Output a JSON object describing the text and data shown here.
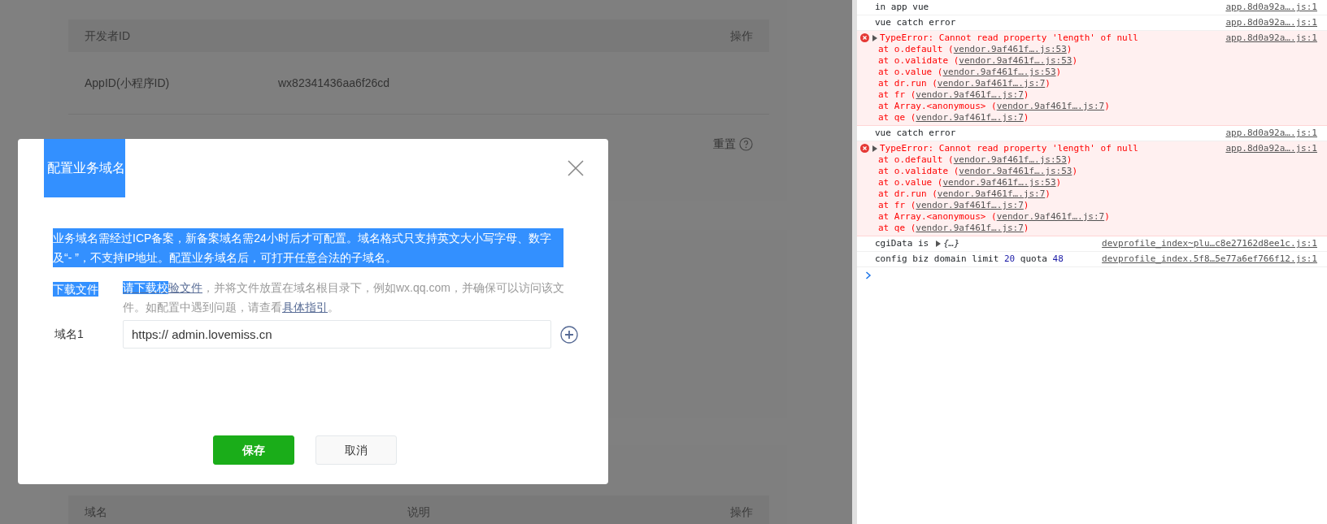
{
  "background_page": {
    "developer_card": {
      "columns": [
        "开发者ID",
        "操作"
      ],
      "rows": [
        {
          "label": "AppID(小程序ID)",
          "value": "wx82341436aa6f26cd"
        }
      ],
      "reset_link": "重置"
    },
    "domain_card": {
      "columns": [
        "域名",
        "说明",
        "操作"
      ]
    }
  },
  "modal": {
    "title": "配置业务域名",
    "title_highlighted": true,
    "description": {
      "text": "业务域名需经过ICP备案，新备案域名需24小时后才可配置。域名格式只支持英文大小写字母、数字及“- ”，不支持IP地址。配置业务域名后，可打开任意合法的子域名。",
      "highlighted": true
    },
    "download": {
      "label": "下载文件",
      "label_highlighted": true,
      "link": [
        {
          "text": "请下载校",
          "highlighted": true
        },
        {
          "text": "验文件",
          "highlighted": false
        }
      ],
      "middle": "，并将文件放置在域名根目录下，例如wx.qq.com，并确保可以访问该文件。如配置中遇到问题，请查看",
      "guide_link": "具体指引",
      "end": "。"
    },
    "domain_fields": [
      {
        "label": "域名1",
        "value": "https:// admin.lovemiss.cn"
      }
    ],
    "buttons": [
      {
        "label": "保存",
        "kind": "primary"
      },
      {
        "label": "取消",
        "kind": "default"
      }
    ]
  },
  "console": [
    {
      "kind": "log",
      "text": "in app vue",
      "source": "app.8d0a92a….js:1"
    },
    {
      "kind": "log",
      "text": "vue catch error",
      "source": "app.8d0a92a….js:1"
    },
    {
      "kind": "error",
      "message": "TypeError: Cannot read property 'length' of null",
      "source": "app.8d0a92a….js:1",
      "stack": [
        {
          "pre": "at o.default (",
          "link": "vendor.9af461f….js:53",
          "post": ")"
        },
        {
          "pre": "at o.validate (",
          "link": "vendor.9af461f….js:53",
          "post": ")"
        },
        {
          "pre": "at o.value (",
          "link": "vendor.9af461f….js:53",
          "post": ")"
        },
        {
          "pre": "at dr.run (",
          "link": "vendor.9af461f….js:7",
          "post": ")"
        },
        {
          "pre": "at fr (",
          "link": "vendor.9af461f….js:7",
          "post": ")"
        },
        {
          "pre": "at Array.<anonymous> (",
          "link": "vendor.9af461f….js:7",
          "post": ")"
        },
        {
          "pre": "at qe (",
          "link": "vendor.9af461f….js:7",
          "post": ")"
        }
      ]
    },
    {
      "kind": "log",
      "text": "vue catch error",
      "source": "app.8d0a92a….js:1"
    },
    {
      "kind": "error",
      "message": "TypeError: Cannot read property 'length' of null",
      "source": "app.8d0a92a….js:1",
      "stack": [
        {
          "pre": "at o.default (",
          "link": "vendor.9af461f….js:53",
          "post": ")"
        },
        {
          "pre": "at o.validate (",
          "link": "vendor.9af461f….js:53",
          "post": ")"
        },
        {
          "pre": "at o.value (",
          "link": "vendor.9af461f….js:53",
          "post": ")"
        },
        {
          "pre": "at dr.run (",
          "link": "vendor.9af461f….js:7",
          "post": ")"
        },
        {
          "pre": "at fr (",
          "link": "vendor.9af461f….js:7",
          "post": ")"
        },
        {
          "pre": "at Array.<anonymous> (",
          "link": "vendor.9af461f….js:7",
          "post": ")"
        },
        {
          "pre": "at qe (",
          "link": "vendor.9af461f….js:7",
          "post": ")"
        }
      ]
    },
    {
      "kind": "object",
      "text": "cgiData is",
      "preview": "{…}",
      "source": "devprofile_index~plu…c8e27162d8ee1c.js:1"
    },
    {
      "kind": "values",
      "parts": [
        {
          "kind": "text",
          "text": "config biz domain limit"
        },
        {
          "kind": "number",
          "text": "20"
        },
        {
          "kind": "text",
          "text": "quota"
        },
        {
          "kind": "number",
          "text": "48"
        }
      ],
      "source": "devprofile_index.5f8…5e77a6ef766f12.js:1"
    }
  ]
}
